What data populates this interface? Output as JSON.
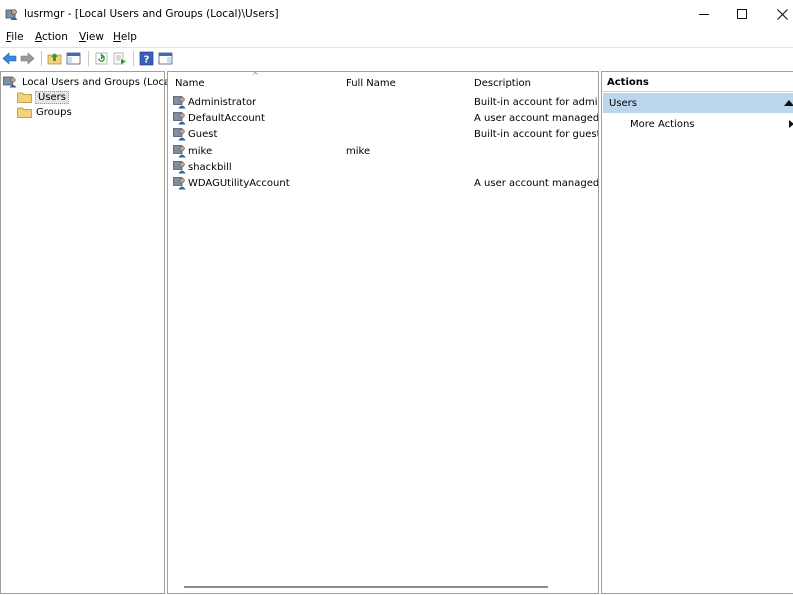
{
  "window": {
    "title": "lusrmgr - [Local Users and Groups (Local)\\Users]",
    "icon": "users-console-icon"
  },
  "menu": {
    "items": [
      {
        "first": "F",
        "rest": "ile"
      },
      {
        "first": "A",
        "rest": "ction"
      },
      {
        "first": "V",
        "rest": "iew"
      },
      {
        "first": "H",
        "rest": "elp"
      }
    ]
  },
  "toolbar": {
    "buttons": [
      "back-icon",
      "forward-icon",
      "up-folder-icon",
      "show-hide-tree-icon",
      "refresh-icon",
      "export-list-icon",
      "help-icon",
      "show-hide-action-pane-icon"
    ]
  },
  "tree": {
    "root": "Local Users and Groups (Local)",
    "children": [
      "Users",
      "Groups"
    ],
    "selected": "Users"
  },
  "list": {
    "columns": [
      "Name",
      "Full Name",
      "Description"
    ],
    "rows": [
      {
        "name": "Administrator",
        "full_name": "",
        "description": "Built-in account for admini"
      },
      {
        "name": "DefaultAccount",
        "full_name": "",
        "description": "A user account managed by"
      },
      {
        "name": "Guest",
        "full_name": "",
        "description": "Built-in account for guest a"
      },
      {
        "name": "mike",
        "full_name": "mike",
        "description": ""
      },
      {
        "name": "shackbill",
        "full_name": "",
        "description": ""
      },
      {
        "name": "WDAGUtilityAccount",
        "full_name": "",
        "description": "A user account managed an"
      }
    ]
  },
  "actions": {
    "title": "Actions",
    "section": "Users",
    "items": [
      "More Actions"
    ]
  },
  "colors": {
    "actions_section_bg": "#bcd6ee",
    "folder": "#f3d27a"
  }
}
